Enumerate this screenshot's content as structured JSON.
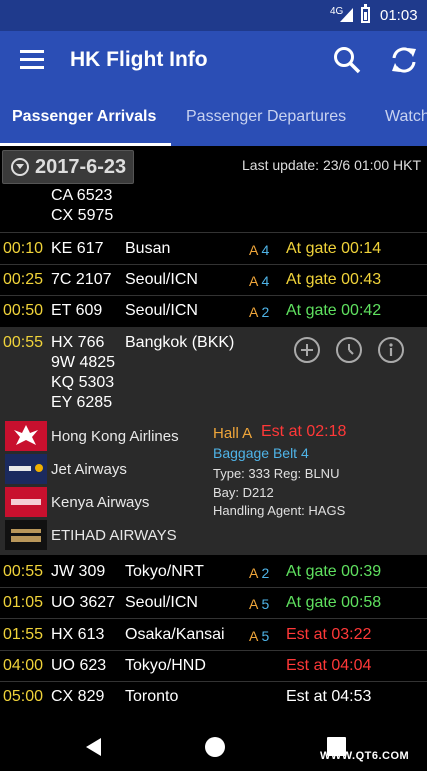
{
  "status_bar": {
    "network": "4G",
    "time": "01:03"
  },
  "app_bar": {
    "title": "HK Flight Info"
  },
  "tabs": [
    {
      "label": "Passenger Arrivals",
      "active": true
    },
    {
      "label": "Passenger Departures",
      "active": false
    },
    {
      "label": "Watch",
      "active": false
    }
  ],
  "header": {
    "date": "2017-6-23",
    "last_update": "Last update: 23/6 01:00 HKT"
  },
  "orphan_codes": [
    "CA 6523",
    "CX 5975"
  ],
  "flights": [
    {
      "time": "00:10",
      "code": "KE 617",
      "city": "Busan",
      "hall": "A",
      "belt": "4",
      "status": "At gate 00:14",
      "status_color": "#f0d33a"
    },
    {
      "time": "00:25",
      "code": "7C 2107",
      "city": "Seoul/ICN",
      "hall": "A",
      "belt": "4",
      "status": "At gate 00:43",
      "status_color": "#f0d33a"
    },
    {
      "time": "00:50",
      "code": "ET 609",
      "city": "Seoul/ICN",
      "hall": "A",
      "belt": "2",
      "status": "At gate 00:42",
      "status_color": "#5fe05f"
    }
  ],
  "expanded_flight": {
    "time": "00:55",
    "codes": [
      "HX 766",
      "9W 4825",
      "KQ 5303",
      "EY 6285"
    ],
    "city": "Bangkok (BKK)",
    "airlines": [
      "Hong Kong Airlines",
      "Jet Airways",
      "Kenya Airways",
      "ETIHAD AIRWAYS"
    ],
    "hall_label": "Hall A",
    "est": "Est at 02:18",
    "baggage": "Baggage Belt 4",
    "type_reg": "Type: 333  Reg: BLNU",
    "bay": "Bay: D212",
    "agent": "Handling Agent: HAGS"
  },
  "flights_after": [
    {
      "time": "00:55",
      "code": "JW 309",
      "city": "Tokyo/NRT",
      "hall": "A",
      "belt": "2",
      "status": "At gate 00:39",
      "status_color": "#5fe05f"
    },
    {
      "time": "01:05",
      "code": "UO 3627",
      "city": "Seoul/ICN",
      "hall": "A",
      "belt": "5",
      "status": "At gate 00:58",
      "status_color": "#5fe05f"
    },
    {
      "time": "01:55",
      "code": "HX 613",
      "city": "Osaka/Kansai",
      "hall": "A",
      "belt": "5",
      "status": "Est at 03:22",
      "status_color": "#ff3838"
    },
    {
      "time": "04:00",
      "code": "UO 623",
      "city": "Tokyo/HND",
      "hall": "",
      "belt": "",
      "status": "Est at 04:04",
      "status_color": "#ff3838"
    },
    {
      "time": "05:00",
      "code": "CX 829",
      "city": "Toronto",
      "hall": "",
      "belt": "",
      "status": "Est at 04:53",
      "status_color": "#ffffff"
    }
  ],
  "watermark": "WWW.QT6.COM",
  "colors": {
    "app_bar": "#2b4eb5",
    "status_bar": "#1f3a8c",
    "time_yellow": "#f0d33a",
    "hall_orange": "#f0a63a",
    "belt_blue": "#4fb4e8",
    "green": "#5fe05f",
    "red": "#ff3838"
  }
}
